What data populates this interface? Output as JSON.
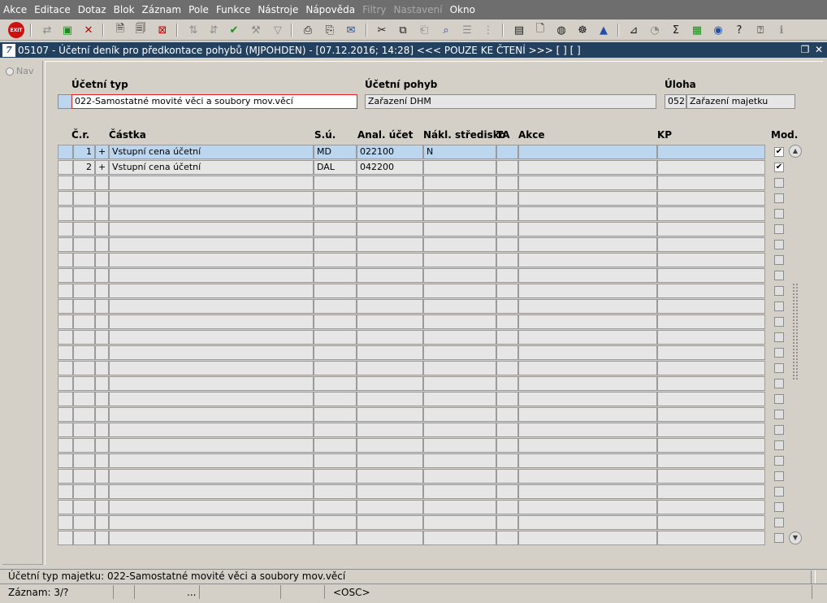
{
  "menu": [
    "Akce",
    "Editace",
    "Dotaz",
    "Blok",
    "Záznam",
    "Pole",
    "Funkce",
    "Nástroje",
    "Nápověda",
    "Filtry",
    "Nastavení",
    "Okno"
  ],
  "menu_disabled": [
    "Filtry",
    "Nastavení"
  ],
  "toolbar": {
    "exit_label": "EXIT"
  },
  "window": {
    "title": "05107 - Účetní deník pro předkontace pohybů (MJPOHDEN) - [07.12.2016; 14:28] <<< POUZE KE ČTENÍ >>>  [ ] [ ]",
    "icon_text": "7"
  },
  "nav": {
    "label": "Nav"
  },
  "form": {
    "ucetni_typ": {
      "label": "Účetní typ",
      "value": "022-Samostatné movité věci a soubory mov.věcí"
    },
    "ucetni_pohyb": {
      "label": "Účetní pohyb",
      "value": "Zařazení DHM"
    },
    "uloha": {
      "label": "Úloha",
      "code": "052",
      "value": "Zařazení majetku"
    }
  },
  "grid": {
    "headers": {
      "cr": "Č.r.",
      "castka": "Částka",
      "su": "S.ú.",
      "anal": "Anal. účet",
      "nakl": "Nákl. středisko",
      "ta": "TA",
      "akce": "Akce",
      "kp": "KP",
      "mod": "Mod."
    },
    "rows": [
      {
        "cr": "1",
        "sign": "+",
        "castka": "Vstupní cena účetní",
        "su": "MD",
        "anal": "022100",
        "nakl": "N",
        "ta": "",
        "akce": "",
        "kp": "",
        "mod": true
      },
      {
        "cr": "2",
        "sign": "+",
        "castka": "Vstupní cena účetní",
        "su": "DAL",
        "anal": "042200",
        "nakl": "",
        "ta": "",
        "akce": "",
        "kp": "",
        "mod": true
      }
    ],
    "empty_row_count": 24
  },
  "status": {
    "line1": "Účetní typ majetku: 022-Samostatné movité věci a soubory mov.věcí",
    "record": "Záznam: 3/?",
    "seg_dots": "...",
    "osc": "<OSC>"
  }
}
